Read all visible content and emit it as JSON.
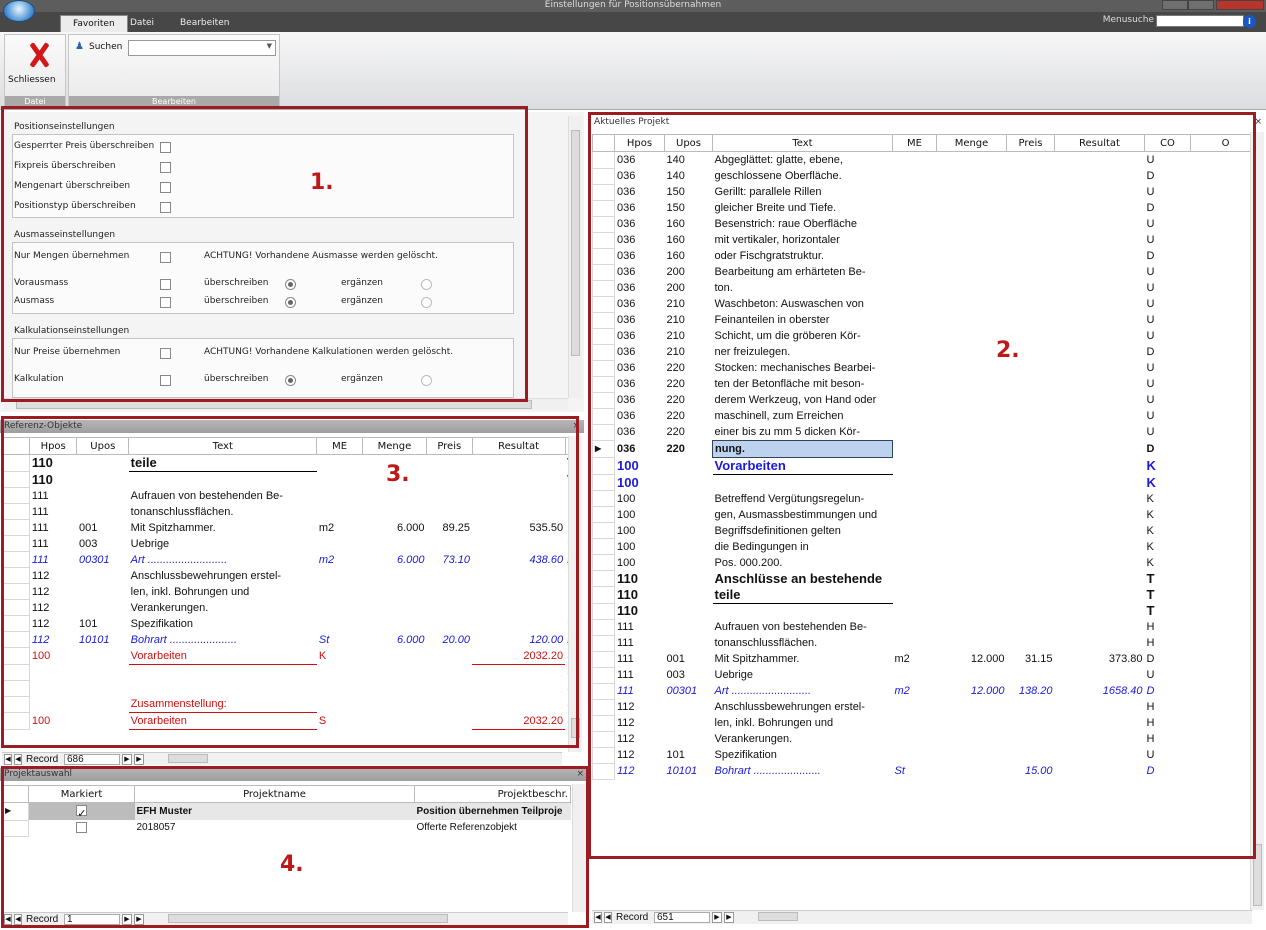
{
  "window": {
    "title": "Einstellungen für Positionsübernahmen"
  },
  "tabs": [
    "Favoriten",
    "Datei",
    "Bearbeiten"
  ],
  "menusuche": "Menusuche",
  "ribbon": {
    "schliessen": "Schliessen",
    "datei_group": "Datei",
    "suchen": "Suchen",
    "bearbeiten_group": "Bearbeiten"
  },
  "settings": {
    "pos_title": "Positionseinstellungen",
    "pos_items": [
      "Gesperrter Preis überschreiben",
      "Fixpreis überschreiben",
      "Mengenart überschreiben",
      "Positionstyp überschreiben"
    ],
    "ausmass_title": "Ausmasseinstellungen",
    "nur_mengen": "Nur Mengen übernehmen",
    "ausmass_warn": "ACHTUNG! Vorhandene Ausmasse werden gelöscht.",
    "vorausmass": "Vorausmass",
    "ausmass": "Ausmass",
    "ueberschreiben": "überschreiben",
    "ergaenzen": "ergänzen",
    "kalk_title": "Kalkulationseinstellungen",
    "nur_preise": "Nur Preise übernehmen",
    "kalk_warn": "ACHTUNG! Vorhandene Kalkulationen werden gelöscht.",
    "kalkulation": "Kalkulation"
  },
  "labels": {
    "one": "1.",
    "two": "2.",
    "three": "3.",
    "four": "4."
  },
  "aktuelles": {
    "title": "Aktuelles Projekt",
    "cols": [
      "Hpos",
      "Upos",
      "Text",
      "ME",
      "Menge",
      "Preis",
      "Resultat",
      "CO",
      "O"
    ],
    "rows": [
      [
        "036",
        "140",
        "Abgeglättet: glatte, ebene,",
        "",
        "",
        "",
        "",
        "U",
        ""
      ],
      [
        "036",
        "140",
        "geschlossene Oberfläche.",
        "",
        "",
        "",
        "",
        "D",
        ""
      ],
      [
        "036",
        "150",
        "Gerillt: parallele Rillen",
        "",
        "",
        "",
        "",
        "U",
        ""
      ],
      [
        "036",
        "150",
        "gleicher Breite und Tiefe.",
        "",
        "",
        "",
        "",
        "D",
        ""
      ],
      [
        "036",
        "160",
        "Besenstrich: raue Oberfläche",
        "",
        "",
        "",
        "",
        "U",
        ""
      ],
      [
        "036",
        "160",
        "mit vertikaler, horizontaler",
        "",
        "",
        "",
        "",
        "U",
        ""
      ],
      [
        "036",
        "160",
        "oder Fischgratstruktur.",
        "",
        "",
        "",
        "",
        "D",
        ""
      ],
      [
        "036",
        "200",
        "Bearbeitung am erhärteten Be-",
        "",
        "",
        "",
        "",
        "U",
        ""
      ],
      [
        "036",
        "200",
        "ton.",
        "",
        "",
        "",
        "",
        "U",
        ""
      ],
      [
        "036",
        "210",
        "Waschbeton: Auswaschen von",
        "",
        "",
        "",
        "",
        "U",
        ""
      ],
      [
        "036",
        "210",
        "Feinanteilen in oberster",
        "",
        "",
        "",
        "",
        "U",
        ""
      ],
      [
        "036",
        "210",
        "Schicht, um die gröberen Kör-",
        "",
        "",
        "",
        "",
        "U",
        ""
      ],
      [
        "036",
        "210",
        "ner freizulegen.",
        "",
        "",
        "",
        "",
        "D",
        ""
      ],
      [
        "036",
        "220",
        "Stocken: mechanisches Bearbei-",
        "",
        "",
        "",
        "",
        "U",
        ""
      ],
      [
        "036",
        "220",
        "ten der Betonfläche mit beson-",
        "",
        "",
        "",
        "",
        "U",
        ""
      ],
      [
        "036",
        "220",
        "derem Werkzeug, von Hand oder",
        "",
        "",
        "",
        "",
        "U",
        ""
      ],
      [
        "036",
        "220",
        "maschinell, zum Erreichen",
        "",
        "",
        "",
        "",
        "U",
        ""
      ],
      [
        "036",
        "220",
        "einer bis zu mm 5 dicken Kör-",
        "",
        "",
        "",
        "",
        "U",
        ""
      ],
      [
        "036",
        "220",
        "nung.",
        "",
        "",
        "",
        "",
        "D",
        "cur"
      ],
      [
        "100",
        "",
        "Vorarbeiten",
        "",
        "",
        "",
        "",
        "K",
        "bigblue"
      ],
      [
        "100",
        "",
        "",
        "",
        "",
        "",
        "",
        "K",
        "bigblue"
      ],
      [
        "100",
        "",
        "Betreffend Vergütungsregelun-",
        "",
        "",
        "",
        "",
        "K",
        ""
      ],
      [
        "100",
        "",
        "gen, Ausmassbestimmungen und",
        "",
        "",
        "",
        "",
        "K",
        ""
      ],
      [
        "100",
        "",
        "Begriffsdefinitionen gelten",
        "",
        "",
        "",
        "",
        "K",
        ""
      ],
      [
        "100",
        "",
        "die Bedingungen in",
        "",
        "",
        "",
        "",
        "K",
        ""
      ],
      [
        "100",
        "",
        "Pos. 000.200.",
        "",
        "",
        "",
        "",
        "K",
        ""
      ],
      [
        "110",
        "",
        "Anschlüsse an bestehende",
        "",
        "",
        "",
        "",
        "T",
        "bold13"
      ],
      [
        "110",
        "",
        "teile",
        "",
        "",
        "",
        "",
        "T",
        "bold13ul"
      ],
      [
        "110",
        "",
        "",
        "",
        "",
        "",
        "",
        "T",
        "bold13"
      ],
      [
        "111",
        "",
        "Aufrauen von bestehenden Be-",
        "",
        "",
        "",
        "",
        "H",
        ""
      ],
      [
        "111",
        "",
        "tonanschlussflächen.",
        "",
        "",
        "",
        "",
        "H",
        ""
      ],
      [
        "111",
        "001",
        "Mit Spitzhammer.",
        "m2",
        "12.000",
        "31.15",
        "373.80",
        "D",
        ""
      ],
      [
        "111",
        "003",
        "Uebrige",
        "",
        "",
        "",
        "",
        "U",
        ""
      ],
      [
        "111",
        "00301",
        "Art ..........................",
        "m2",
        "12.000",
        "138.20",
        "1658.40",
        "D",
        "it"
      ],
      [
        "112",
        "",
        "Anschlussbewehrungen erstel-",
        "",
        "",
        "",
        "",
        "H",
        ""
      ],
      [
        "112",
        "",
        "len, inkl. Bohrungen und",
        "",
        "",
        "",
        "",
        "H",
        ""
      ],
      [
        "112",
        "",
        "Verankerungen.",
        "",
        "",
        "",
        "",
        "H",
        ""
      ],
      [
        "112",
        "101",
        "Spezifikation",
        "",
        "",
        "",
        "",
        "U",
        ""
      ],
      [
        "112",
        "10101",
        "Bohrart ......................",
        "St",
        "",
        "15.00",
        "",
        "D",
        "it"
      ]
    ],
    "record_label": "Record",
    "record": "651"
  },
  "referenz": {
    "title": "Referenz-Objekte",
    "cols": [
      "Hpos",
      "Upos",
      "Text",
      "ME",
      "Menge",
      "Preis",
      "Resultat",
      ""
    ],
    "rows": [
      [
        "110",
        "",
        "teile",
        "",
        "",
        "",
        "",
        "T",
        "bold13ul"
      ],
      [
        "110",
        "",
        "",
        "",
        "",
        "",
        "",
        "T",
        "bold13"
      ],
      [
        "111",
        "",
        "Aufrauen von bestehenden Be-",
        "",
        "",
        "",
        "",
        "H",
        ""
      ],
      [
        "111",
        "",
        "tonanschlussflächen.",
        "",
        "",
        "",
        "",
        "H",
        ""
      ],
      [
        "111",
        "001",
        "Mit Spitzhammer.",
        "m2",
        "6.000",
        "89.25",
        "535.50",
        "D",
        ""
      ],
      [
        "111",
        "003",
        "Uebrige",
        "",
        "",
        "",
        "",
        "U",
        ""
      ],
      [
        "111",
        "00301",
        "Art ..........................",
        "m2",
        "6.000",
        "73.10",
        "438.60",
        "D",
        "it"
      ],
      [
        "112",
        "",
        "Anschlussbewehrungen erstel-",
        "",
        "",
        "",
        "",
        "H",
        ""
      ],
      [
        "112",
        "",
        "len, inkl. Bohrungen und",
        "",
        "",
        "",
        "",
        "H",
        ""
      ],
      [
        "112",
        "",
        "Verankerungen.",
        "",
        "",
        "",
        "",
        "H",
        ""
      ],
      [
        "112",
        "101",
        "Spezifikation",
        "",
        "",
        "",
        "",
        "U",
        ""
      ],
      [
        "112",
        "10101",
        "Bohrart ......................",
        "St",
        "6.000",
        "20.00",
        "120.00",
        "D",
        "it"
      ],
      [
        "100",
        "",
        "Vorarbeiten",
        "K",
        "",
        "",
        "2032.20",
        "S",
        "red"
      ],
      [
        "",
        "",
        "",
        "",
        "",
        "",
        "",
        "S",
        "red"
      ],
      [
        "",
        "",
        "",
        "",
        "",
        "",
        "",
        "S",
        "red"
      ],
      [
        "",
        "",
        "Zusammenstellung:",
        "",
        "",
        "",
        "",
        "S",
        "red"
      ],
      [
        "100",
        "",
        "Vorarbeiten",
        "S",
        "",
        "",
        "2032.20",
        "S",
        "redul"
      ]
    ],
    "record_label": "Record",
    "record": "686"
  },
  "projekt": {
    "title": "Projektauswahl",
    "cols": [
      "Markiert",
      "Projektname",
      "Projektbeschr."
    ],
    "rows": [
      {
        "checked": true,
        "name": "EFH Muster",
        "desc": "Position übernehmen Teilproje"
      },
      {
        "checked": false,
        "name": "2018057",
        "desc": "Offerte Referenzobjekt"
      }
    ],
    "record_label": "Record",
    "record": "1"
  }
}
